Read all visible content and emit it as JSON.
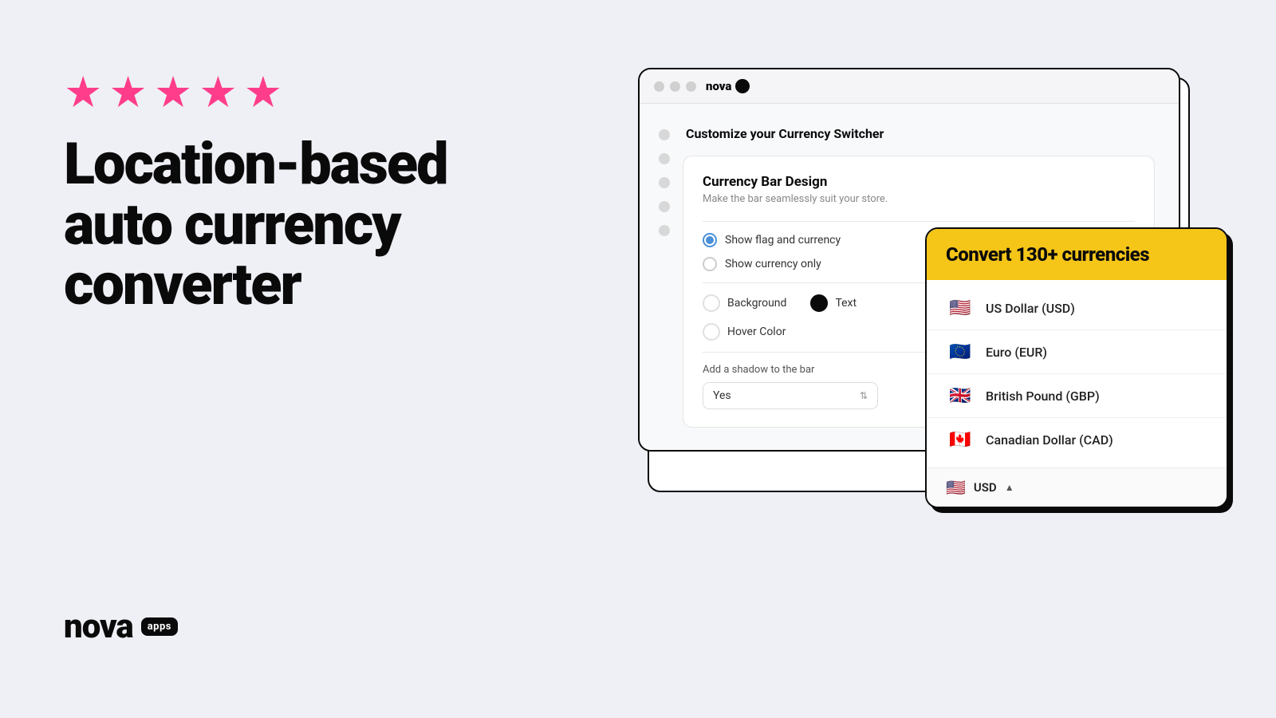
{
  "background_color": "#eef0f6",
  "left": {
    "stars_count": 5,
    "star_char": "★",
    "star_color": "#ff3d8b",
    "headline": "Location-based auto currency converter",
    "logo_text": "nova",
    "logo_badge": "apps"
  },
  "browser": {
    "title_logo": "nova",
    "title_dot": "●",
    "traffic_lights": [
      "●",
      "●",
      "●"
    ],
    "panel": {
      "title": "Customize your Currency Switcher",
      "section_title": "Currency Bar Design",
      "section_subtitle": "Make the bar seamlessly suit your store.",
      "radio_options": [
        {
          "label": "Show flag and currency",
          "active": true
        },
        {
          "label": "Show currency only",
          "active": false
        }
      ],
      "color_options": [
        {
          "label": "Background",
          "style": "empty"
        },
        {
          "label": "Text",
          "style": "black"
        }
      ],
      "hover_color_label": "Hover Color",
      "shadow_label": "Add a shadow to the bar",
      "shadow_value": "Yes"
    },
    "sidebar_dots_count": 5
  },
  "currency_dropdown": {
    "header": "Convert 130+ currencies",
    "currencies": [
      {
        "flag": "🇺🇸",
        "name": "US Dollar (USD)"
      },
      {
        "flag": "🇪🇺",
        "name": "Euro (EUR)"
      },
      {
        "flag": "🇬🇧",
        "name": "British Pound (GBP)"
      },
      {
        "flag": "🇨🇦",
        "name": "Canadian Dollar (CAD)"
      }
    ],
    "bottom_bar": {
      "flag": "🇺🇸",
      "currency": "USD",
      "arrow": "▲"
    }
  }
}
